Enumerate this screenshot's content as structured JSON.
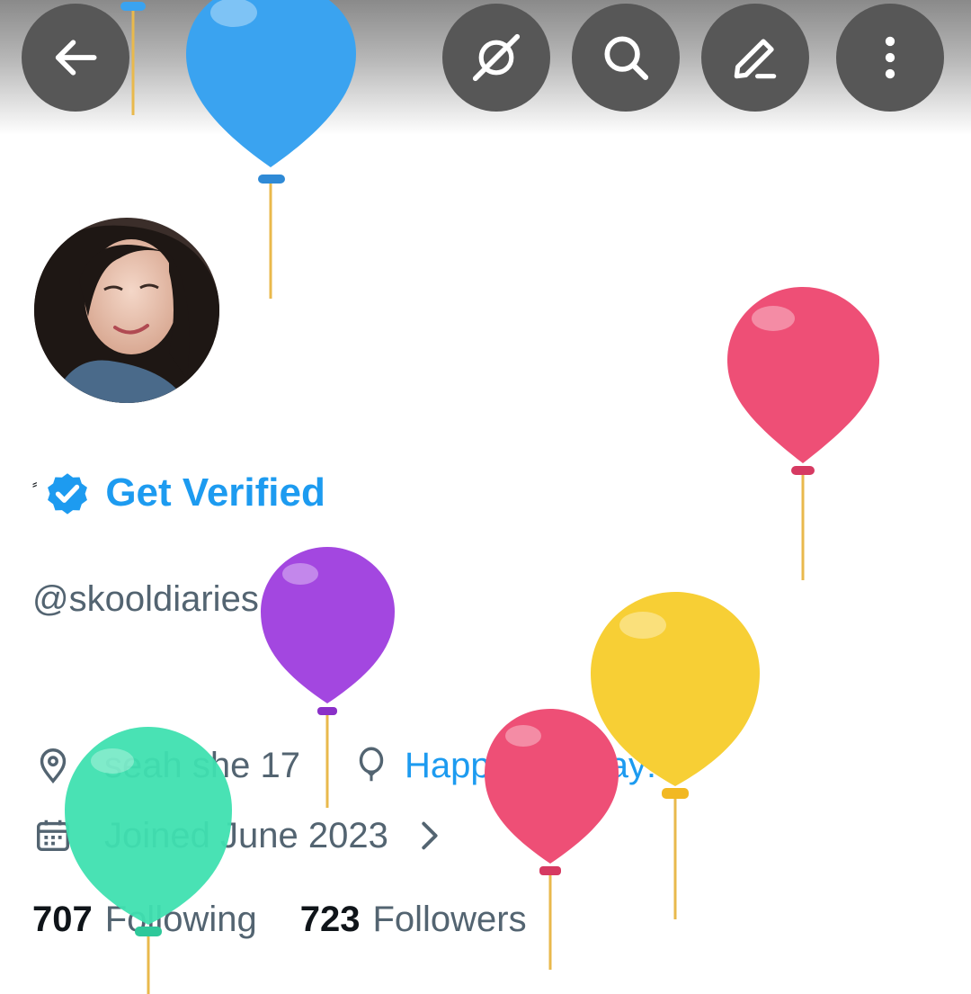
{
  "header": {
    "back_icon": "arrow-left-icon",
    "actions": [
      "grok-icon",
      "search-icon",
      "edit-pencil-icon",
      "more-vertical-icon"
    ]
  },
  "profile": {
    "display_name": "⸗",
    "verified_badge_icon": "verified-badge-icon",
    "get_verified_label": "Get Verified",
    "handle": "@skooldiaries",
    "location": "seah  she  17",
    "birthday_label": "Happy birthday!",
    "joined": "Joined June 2023",
    "following_count": "707",
    "following_label": "Following",
    "followers_count": "723",
    "followers_label": "Followers"
  },
  "colors": {
    "accent": "#1d9bf0",
    "secondary_text": "#536471",
    "primary_text": "#0f1419",
    "header_button": "#575757",
    "balloon_blue": "#3aa3f0",
    "balloon_pink": "#ee4f76",
    "balloon_purple": "#a347e0",
    "balloon_yellow": "#f7cf35",
    "balloon_green": "#3fe0b0"
  }
}
